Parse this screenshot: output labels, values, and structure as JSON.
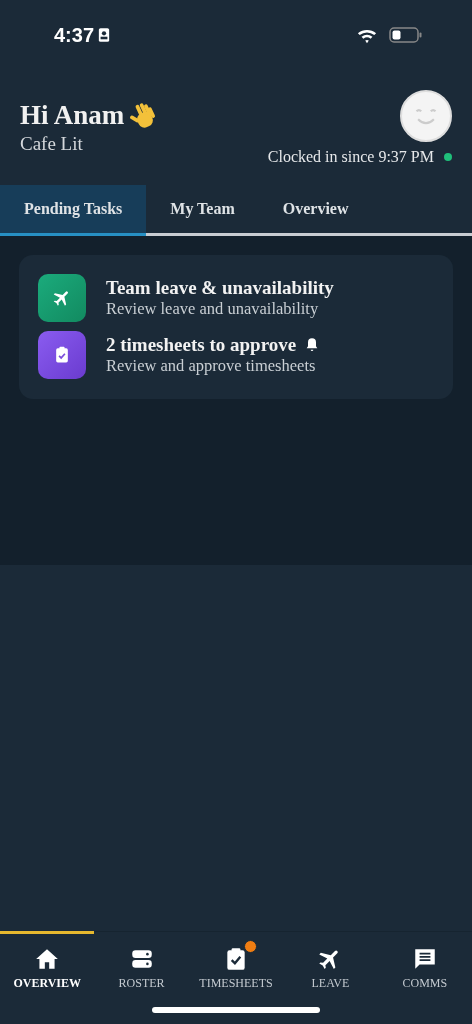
{
  "status_bar": {
    "time": "4:37"
  },
  "header": {
    "greeting": "Hi Anam",
    "workplace": "Cafe Lit",
    "clock_status": "Clocked in since 9:37 PM",
    "online": true
  },
  "tabs": [
    {
      "label": "Pending Tasks",
      "selected": true
    },
    {
      "label": "My Team",
      "selected": false
    },
    {
      "label": "Overview",
      "selected": false
    }
  ],
  "tasks": [
    {
      "kind": "leave",
      "title": "Team leave & unavailability",
      "subtitle": "Review leave and unavailability",
      "alert": false
    },
    {
      "kind": "timesheet",
      "title": "2 timesheets to approve",
      "subtitle": "Review and approve timesheets",
      "alert": true
    }
  ],
  "nav": [
    {
      "kind": "home",
      "label": "OVERVIEW",
      "selected": true,
      "badge": false
    },
    {
      "kind": "roster",
      "label": "ROSTER",
      "selected": false,
      "badge": false
    },
    {
      "kind": "timesheet",
      "label": "TIMESHEETS",
      "selected": false,
      "badge": true
    },
    {
      "kind": "leave",
      "label": "LEAVE",
      "selected": false,
      "badge": false
    },
    {
      "kind": "comms",
      "label": "COMMS",
      "selected": false,
      "badge": false
    }
  ]
}
